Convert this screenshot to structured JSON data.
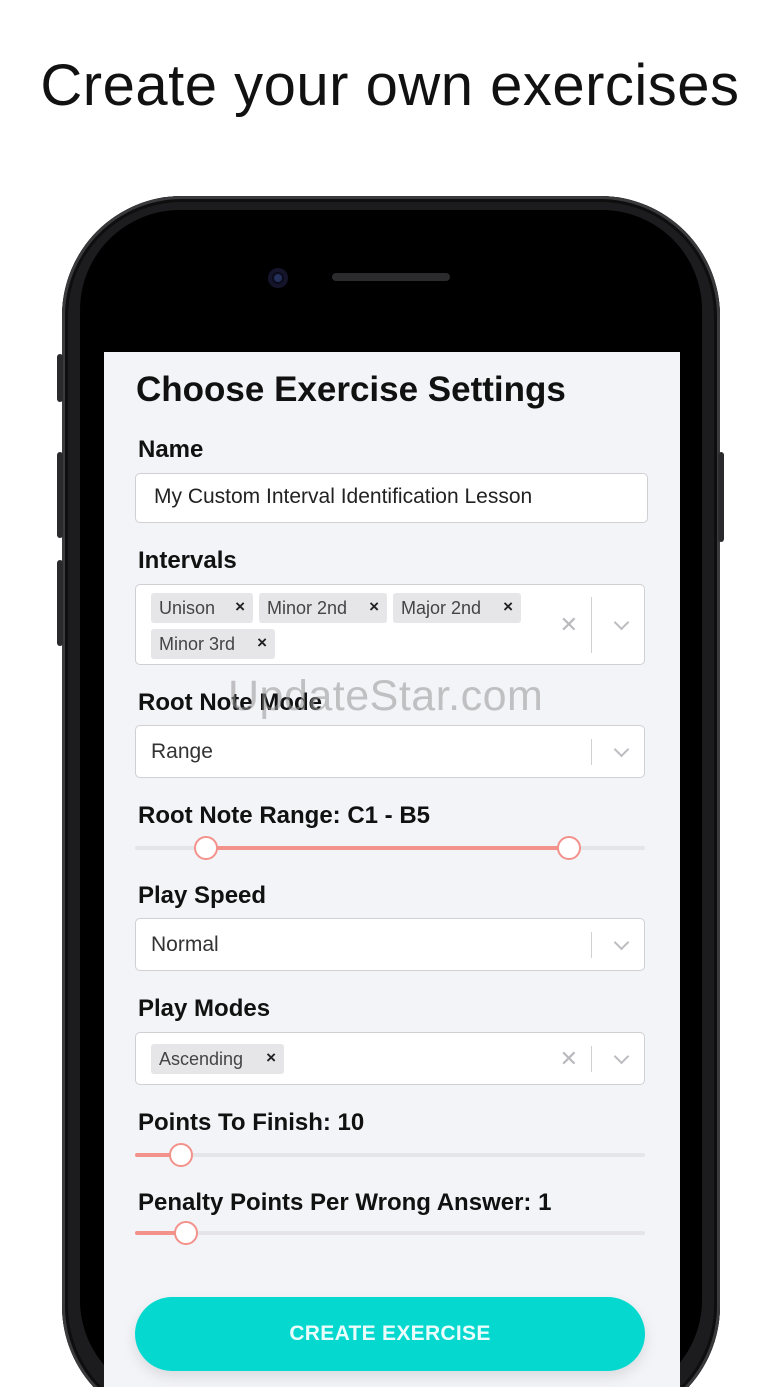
{
  "headline": "Create your own exercises",
  "form": {
    "title": "Choose Exercise Settings",
    "name": {
      "label": "Name",
      "value": "My Custom Interval Identification Lesson"
    },
    "intervals": {
      "label": "Intervals",
      "chips": [
        "Unison",
        "Minor 2nd",
        "Major 2nd",
        "Minor 3rd"
      ]
    },
    "root_note_mode": {
      "label": "Root Note Mode",
      "value": "Range"
    },
    "root_note_range": {
      "label": "Root Note Range: C1 - B5",
      "low_fraction": 0.14,
      "high_fraction": 0.85
    },
    "play_speed": {
      "label": "Play Speed",
      "value": "Normal"
    },
    "play_modes": {
      "label": "Play Modes",
      "chips": [
        "Ascending"
      ]
    },
    "points_to_finish": {
      "label": "Points To Finish: 10",
      "fraction": 0.09
    },
    "penalty_points": {
      "label": "Penalty Points Per Wrong Answer: 1",
      "fraction": 0.1
    },
    "create_button": "CREATE EXERCISE"
  },
  "icons": {
    "remove": "×",
    "clear": "✕"
  },
  "colors": {
    "accent": "#05d9cf",
    "slider": "#f3918b"
  },
  "watermark": "UpdateStar.com"
}
